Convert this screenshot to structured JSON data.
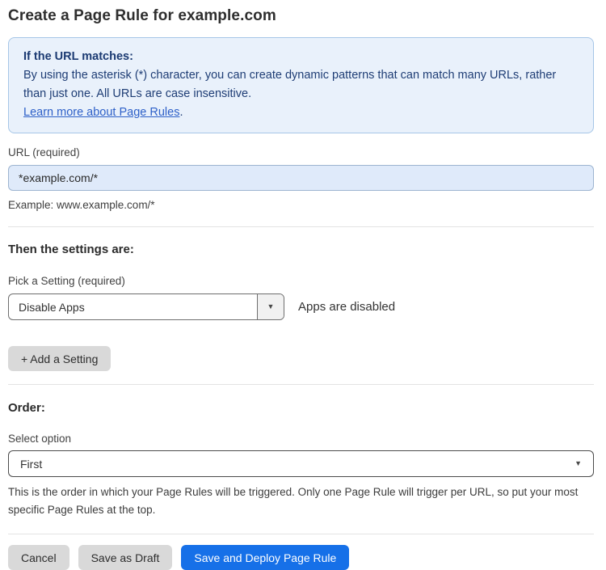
{
  "page": {
    "title": "Create a Page Rule for example.com"
  },
  "info_box": {
    "heading": "If the URL matches:",
    "body": "By using the asterisk (*) character, you can create dynamic patterns that can match many URLs, rather than just one. All URLs are case insensitive.",
    "link_label": "Learn more about Page Rules",
    "link_suffix": "."
  },
  "url_field": {
    "label": "URL (required)",
    "value": "*example.com/*",
    "helper": "Example: www.example.com/*"
  },
  "settings_section": {
    "heading": "Then the settings are:",
    "picker_label": "Pick a Setting (required)",
    "selected_setting": "Disable Apps",
    "setting_status": "Apps are disabled",
    "add_setting_label": "+ Add a Setting"
  },
  "order_section": {
    "heading": "Order:",
    "select_label": "Select option",
    "selected_option": "First",
    "helper": "This is the order in which your Page Rules will be triggered. Only one Page Rule will trigger per URL, so put your most specific Page Rules at the top."
  },
  "footer": {
    "cancel_label": "Cancel",
    "save_draft_label": "Save as Draft",
    "save_deploy_label": "Save and Deploy Page Rule"
  },
  "icons": {
    "dropdown_arrow": "▼"
  },
  "colors": {
    "primary_button": "#1670e8",
    "info_background": "#e9f1fb",
    "info_border": "#a6c6e7",
    "info_text": "#1e3d75",
    "link": "#2d60c8",
    "input_background": "#dfeafa"
  }
}
